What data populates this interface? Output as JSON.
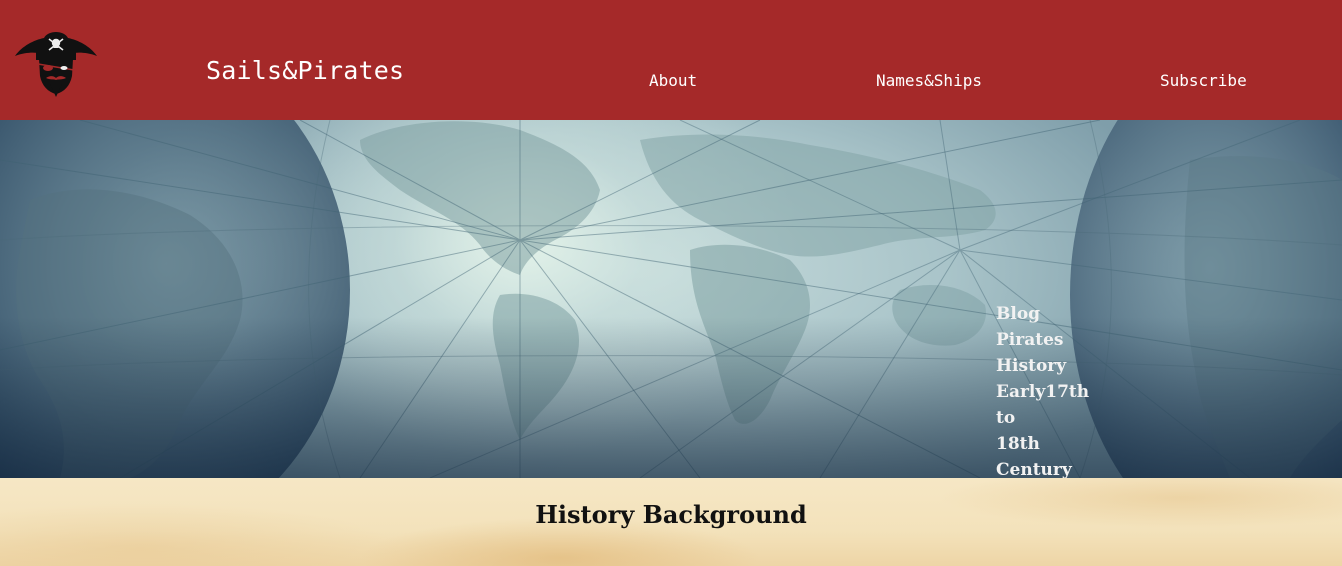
{
  "header": {
    "logo_icon": "pirate-head-icon",
    "brand": "Sails&Pirates",
    "background_color": "#a52929",
    "nav": [
      {
        "label": "About"
      },
      {
        "label": "Names&Ships"
      },
      {
        "label": "Subscribe"
      }
    ]
  },
  "hero": {
    "background_icon": "world-map-icon",
    "title_lines": [
      "Blog",
      "Pirates",
      "History",
      "Early17th",
      "to",
      "18th",
      "Century"
    ]
  },
  "section": {
    "title": "History Background"
  }
}
